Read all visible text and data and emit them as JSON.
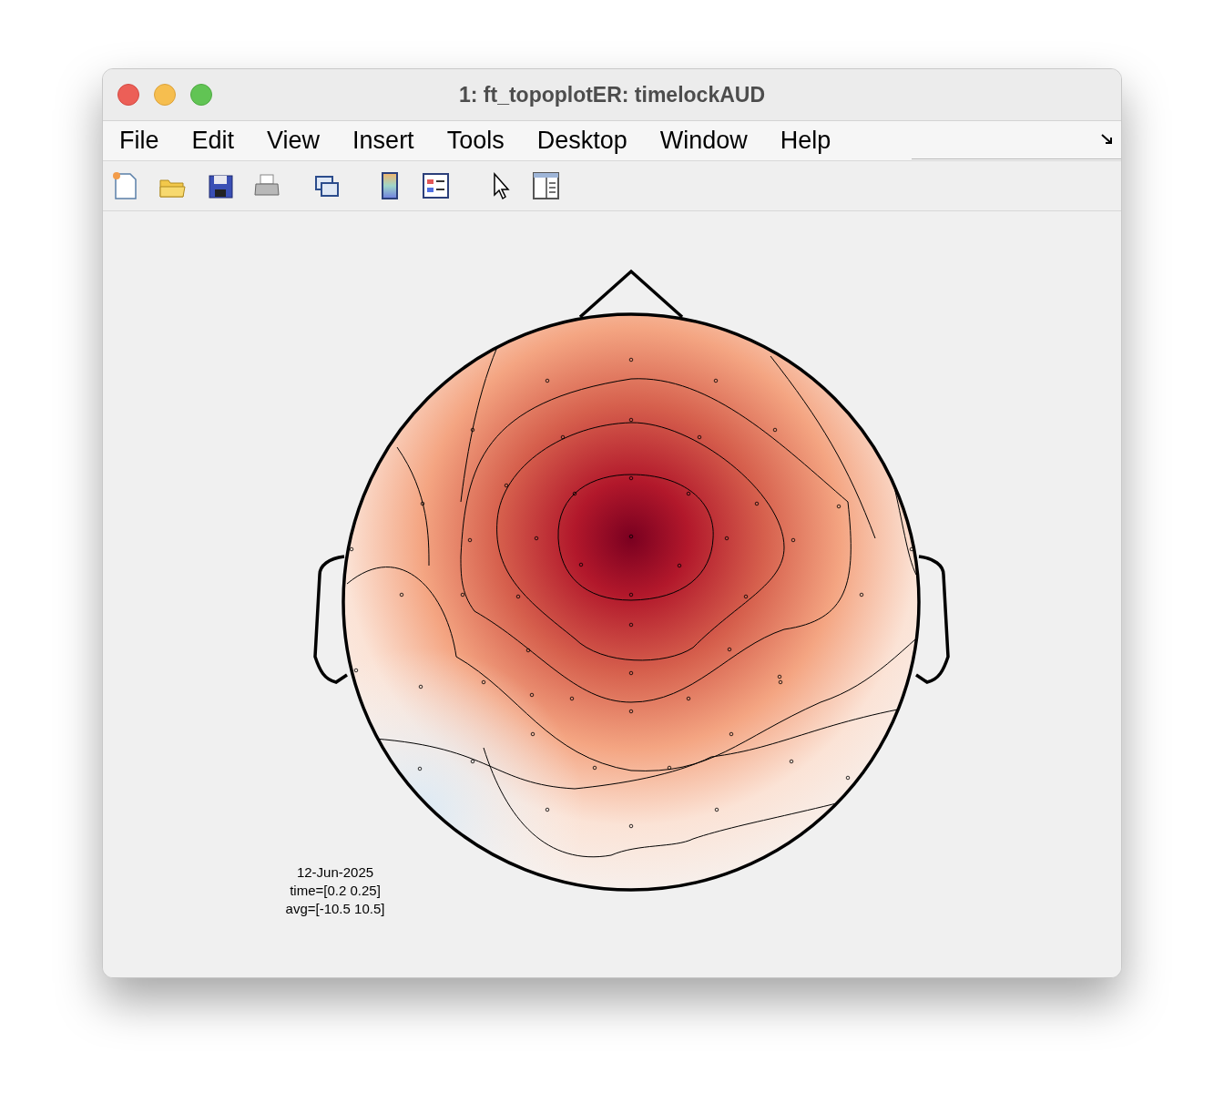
{
  "window": {
    "title": "1: ft_topoplotER: timelockAUD"
  },
  "menu": [
    {
      "label": "File"
    },
    {
      "label": "Edit"
    },
    {
      "label": "View"
    },
    {
      "label": "Insert"
    },
    {
      "label": "Tools"
    },
    {
      "label": "Desktop"
    },
    {
      "label": "Window"
    },
    {
      "label": "Help"
    }
  ],
  "plot": {
    "annotation": [
      "12-Jun-2025",
      "time=[0.2 0.25]",
      "avg=[-10.5 10.5]"
    ]
  }
}
